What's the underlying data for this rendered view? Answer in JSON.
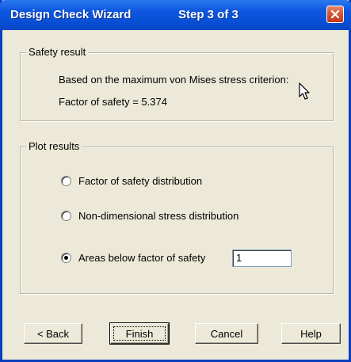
{
  "window": {
    "title": "Design Check Wizard",
    "step": "Step 3 of 3",
    "close_icon": "close-icon"
  },
  "safety_result": {
    "label": "Safety result",
    "criterion_text": "Based on the maximum von Mises stress criterion:",
    "factor_text": "Factor of safety = 5.374"
  },
  "plot_results": {
    "label": "Plot results",
    "options": [
      {
        "label": "Factor of safety distribution",
        "selected": false
      },
      {
        "label": "Non-dimensional stress distribution",
        "selected": false
      },
      {
        "label": "Areas below factor of safety",
        "selected": true
      }
    ],
    "threshold_value": "1"
  },
  "buttons": {
    "back": "< Back",
    "finish": "Finish",
    "cancel": "Cancel",
    "help": "Help"
  },
  "colors": {
    "titlebar": "#0850d6",
    "dialog_bg": "#ece9d8",
    "close_button": "#d8522f"
  }
}
